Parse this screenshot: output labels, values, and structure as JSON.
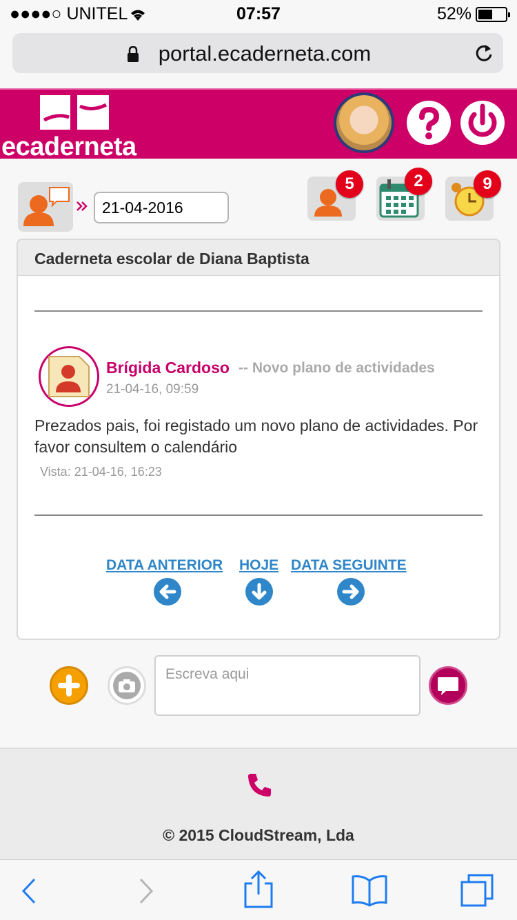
{
  "status_bar": {
    "carrier": "●●●●○ UNITEL",
    "time": "07:57",
    "battery": "52%"
  },
  "browser": {
    "url": "portal.ecaderneta.com"
  },
  "header": {
    "logo_text": "ecaderneta",
    "brand_color": "#cc0066"
  },
  "toolbar": {
    "date_value": "21-04-2016",
    "messages_badge": "5",
    "calendar_badge": "2",
    "alarm_badge": "9"
  },
  "card": {
    "title": "Caderneta escolar de Diana Baptista",
    "message": {
      "author": "Brígida Cardoso",
      "subject": "-- Novo plano de actividades",
      "date": "21-04-16, 09:59",
      "body": "Prezados pais, foi registado um novo plano de actividades. Por favor consultem o calendário",
      "seen": "Vista: 21-04-16, 16:23"
    },
    "nav": {
      "previous": "DATA ANTERIOR",
      "today": "HOJE",
      "next": "DATA SEGUINTE"
    }
  },
  "compose": {
    "placeholder": "Escreva aqui"
  },
  "footer": {
    "copyright": "© 2015 CloudStream, Lda"
  }
}
